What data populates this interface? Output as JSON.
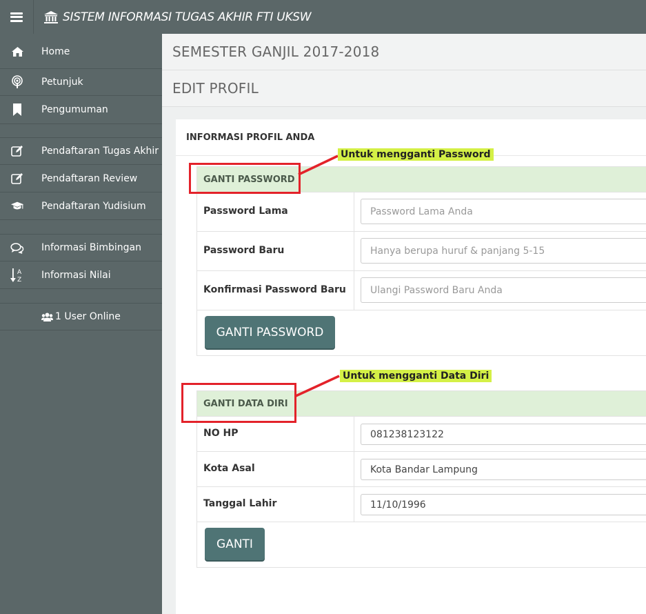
{
  "header": {
    "title": "SISTEM INFORMASI TUGAS AKHIR FTI UKSW"
  },
  "sidebar": {
    "items": [
      {
        "label": "Home",
        "icon": "home-icon"
      },
      {
        "label": "Petunjuk",
        "icon": "podcast-icon"
      },
      {
        "label": "Pengumuman",
        "icon": "bookmark-icon"
      },
      {
        "label": "Pendaftaran Tugas Akhir",
        "icon": "edit-icon"
      },
      {
        "label": "Pendaftaran Review",
        "icon": "edit-icon"
      },
      {
        "label": "Pendaftaran Yudisium",
        "icon": "graduation-cap-icon"
      },
      {
        "label": "Informasi Bimbingan",
        "icon": "comments-icon"
      },
      {
        "label": "Informasi Nilai",
        "icon": "sort-alpha-icon"
      }
    ],
    "online_text": "1 User Online"
  },
  "page": {
    "semester": "SEMESTER GANJIL 2017-2018",
    "title": "EDIT PROFIL"
  },
  "card": {
    "title": "INFORMASI PROFIL ANDA"
  },
  "password_section": {
    "heading": "GANTI PASSWORD",
    "rows": [
      {
        "label": "Password Lama",
        "placeholder": "Password Lama Anda",
        "value": ""
      },
      {
        "label": "Password Baru",
        "placeholder": "Hanya berupa huruf & panjang 5-15",
        "value": ""
      },
      {
        "label": "Konfirmasi Password Baru",
        "placeholder": "Ulangi Password Baru Anda",
        "value": ""
      }
    ],
    "button": "GANTI PASSWORD"
  },
  "data_section": {
    "heading": "GANTI DATA DIRI",
    "rows": [
      {
        "label": "NO HP",
        "value": "081238123122"
      },
      {
        "label": "Kota Asal",
        "value": "Kota Bandar Lampung"
      },
      {
        "label": "Tanggal Lahir",
        "value": "11/10/1996"
      }
    ],
    "button": "GANTI"
  },
  "annotations": {
    "password_note": "Untuk mengganti Password",
    "data_note": "Untuk mengganti Data Diri",
    "highlight_color": "#e3222a",
    "label_color": "#d4f046"
  },
  "colors": {
    "sidebar": "#5b6768",
    "section_header": "#dff0d8",
    "button": "#4f7475"
  }
}
